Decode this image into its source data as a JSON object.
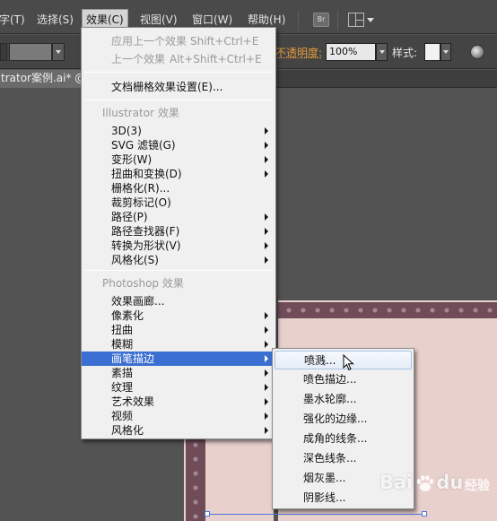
{
  "menubar": {
    "items": [
      "字(T)",
      "选择(S)",
      "效果(C)",
      "视图(V)",
      "窗口(W)",
      "帮助(H)"
    ],
    "active_index": 2,
    "bridge_label": "Br"
  },
  "control_bar": {
    "opacity_label": "不透明度:",
    "opacity_value": "100%",
    "style_label": "样式:"
  },
  "document_tab": {
    "title": "trator案例.ai* @"
  },
  "effect_menu": {
    "items": [
      {
        "label": "应用上一个效果",
        "shortcut": "Shift+Ctrl+E",
        "disabled": true
      },
      {
        "label": "上一个效果",
        "shortcut": "Alt+Shift+Ctrl+E",
        "disabled": true
      },
      {
        "label": "文档栅格效果设置(E)..."
      },
      {
        "label": "Illustrator 效果",
        "header": true
      },
      {
        "label": "3D(3)",
        "submenu": true
      },
      {
        "label": "SVG 滤镜(G)",
        "submenu": true
      },
      {
        "label": "变形(W)",
        "submenu": true
      },
      {
        "label": "扭曲和变换(D)",
        "submenu": true
      },
      {
        "label": "栅格化(R)..."
      },
      {
        "label": "裁剪标记(O)"
      },
      {
        "label": "路径(P)",
        "submenu": true
      },
      {
        "label": "路径查找器(F)",
        "submenu": true
      },
      {
        "label": "转换为形状(V)",
        "submenu": true
      },
      {
        "label": "风格化(S)",
        "submenu": true
      },
      {
        "label": "Photoshop 效果",
        "header": true
      },
      {
        "label": "效果画廊..."
      },
      {
        "label": "像素化",
        "submenu": true
      },
      {
        "label": "扭曲",
        "submenu": true
      },
      {
        "label": "模糊",
        "submenu": true
      },
      {
        "label": "画笔描边",
        "submenu": true,
        "highlighted": true
      },
      {
        "label": "素描",
        "submenu": true
      },
      {
        "label": "纹理",
        "submenu": true
      },
      {
        "label": "艺术效果",
        "submenu": true
      },
      {
        "label": "视频",
        "submenu": true
      },
      {
        "label": "风格化",
        "submenu": true
      }
    ]
  },
  "brush_submenu": {
    "items": [
      "喷溅...",
      "喷色描边...",
      "墨水轮廓...",
      "强化的边缘...",
      "成角的线条...",
      "深色线条...",
      "烟灰墨...",
      "阴影线..."
    ],
    "hover_index": 0
  },
  "watermark": {
    "brand": "Bai",
    "brand_tail": "du",
    "sub": "经验"
  }
}
